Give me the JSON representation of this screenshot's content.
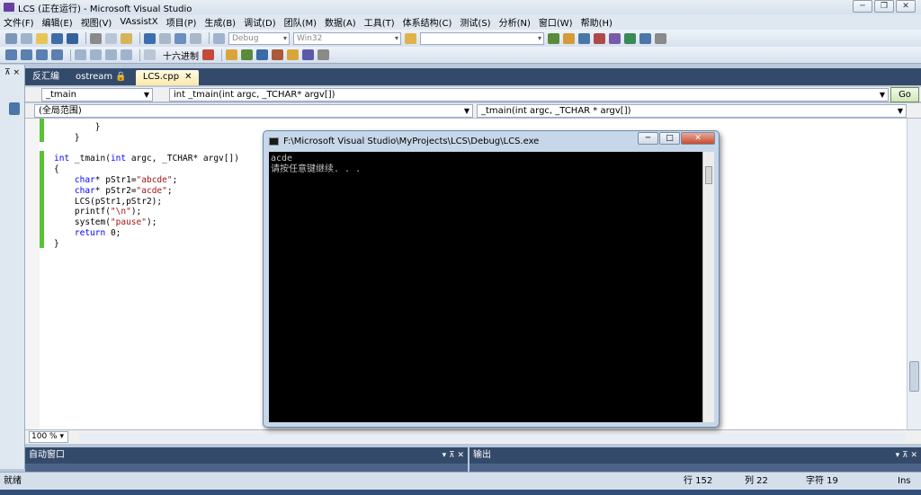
{
  "window": {
    "title": "LCS (正在运行) - Microsoft Visual Studio"
  },
  "menu": [
    "文件(F)",
    "编辑(E)",
    "视图(V)",
    "VAssistX",
    "项目(P)",
    "生成(B)",
    "调试(D)",
    "团队(M)",
    "数据(A)",
    "工具(T)",
    "体系结构(C)",
    "测试(S)",
    "分析(N)",
    "窗口(W)",
    "帮助(H)"
  ],
  "toolbar": {
    "config": "Debug",
    "platform": "Win32",
    "hex_label": "十六进制"
  },
  "tabs": [
    {
      "label": "反汇编",
      "active": false
    },
    {
      "label": "ostream",
      "active": false
    },
    {
      "label": "LCS.cpp",
      "active": true
    }
  ],
  "nav": {
    "left_combo": "_tmain",
    "right_combo": "int _tmain(int argc, _TCHAR* argv[])",
    "go_label": "Go"
  },
  "scope": {
    "left": "(全局范围)",
    "right": "_tmain(int argc, _TCHAR * argv[])"
  },
  "code_lines": [
    "        }",
    "    }",
    "",
    "int _tmain(int argc, _TCHAR* argv[])",
    "{",
    "    char* pStr1=\"abcde\";",
    "    char* pStr2=\"acde\";",
    "    LCS(pStr1,pStr2);",
    "    printf(\"\\n\");",
    "    system(\"pause\");",
    "    return 0;",
    "}"
  ],
  "console": {
    "title": "F:\\Microsoft Visual Studio\\MyProjects\\LCS\\Debug\\LCS.exe",
    "output": [
      "acde",
      "请按任意键继续. . ."
    ]
  },
  "zoom": "100 %",
  "panels": {
    "left": "自动窗口",
    "right": "输出"
  },
  "status": {
    "ready": "就绪",
    "line": "行 152",
    "col": "列 22",
    "char": "字符 19",
    "mode": "Ins"
  }
}
